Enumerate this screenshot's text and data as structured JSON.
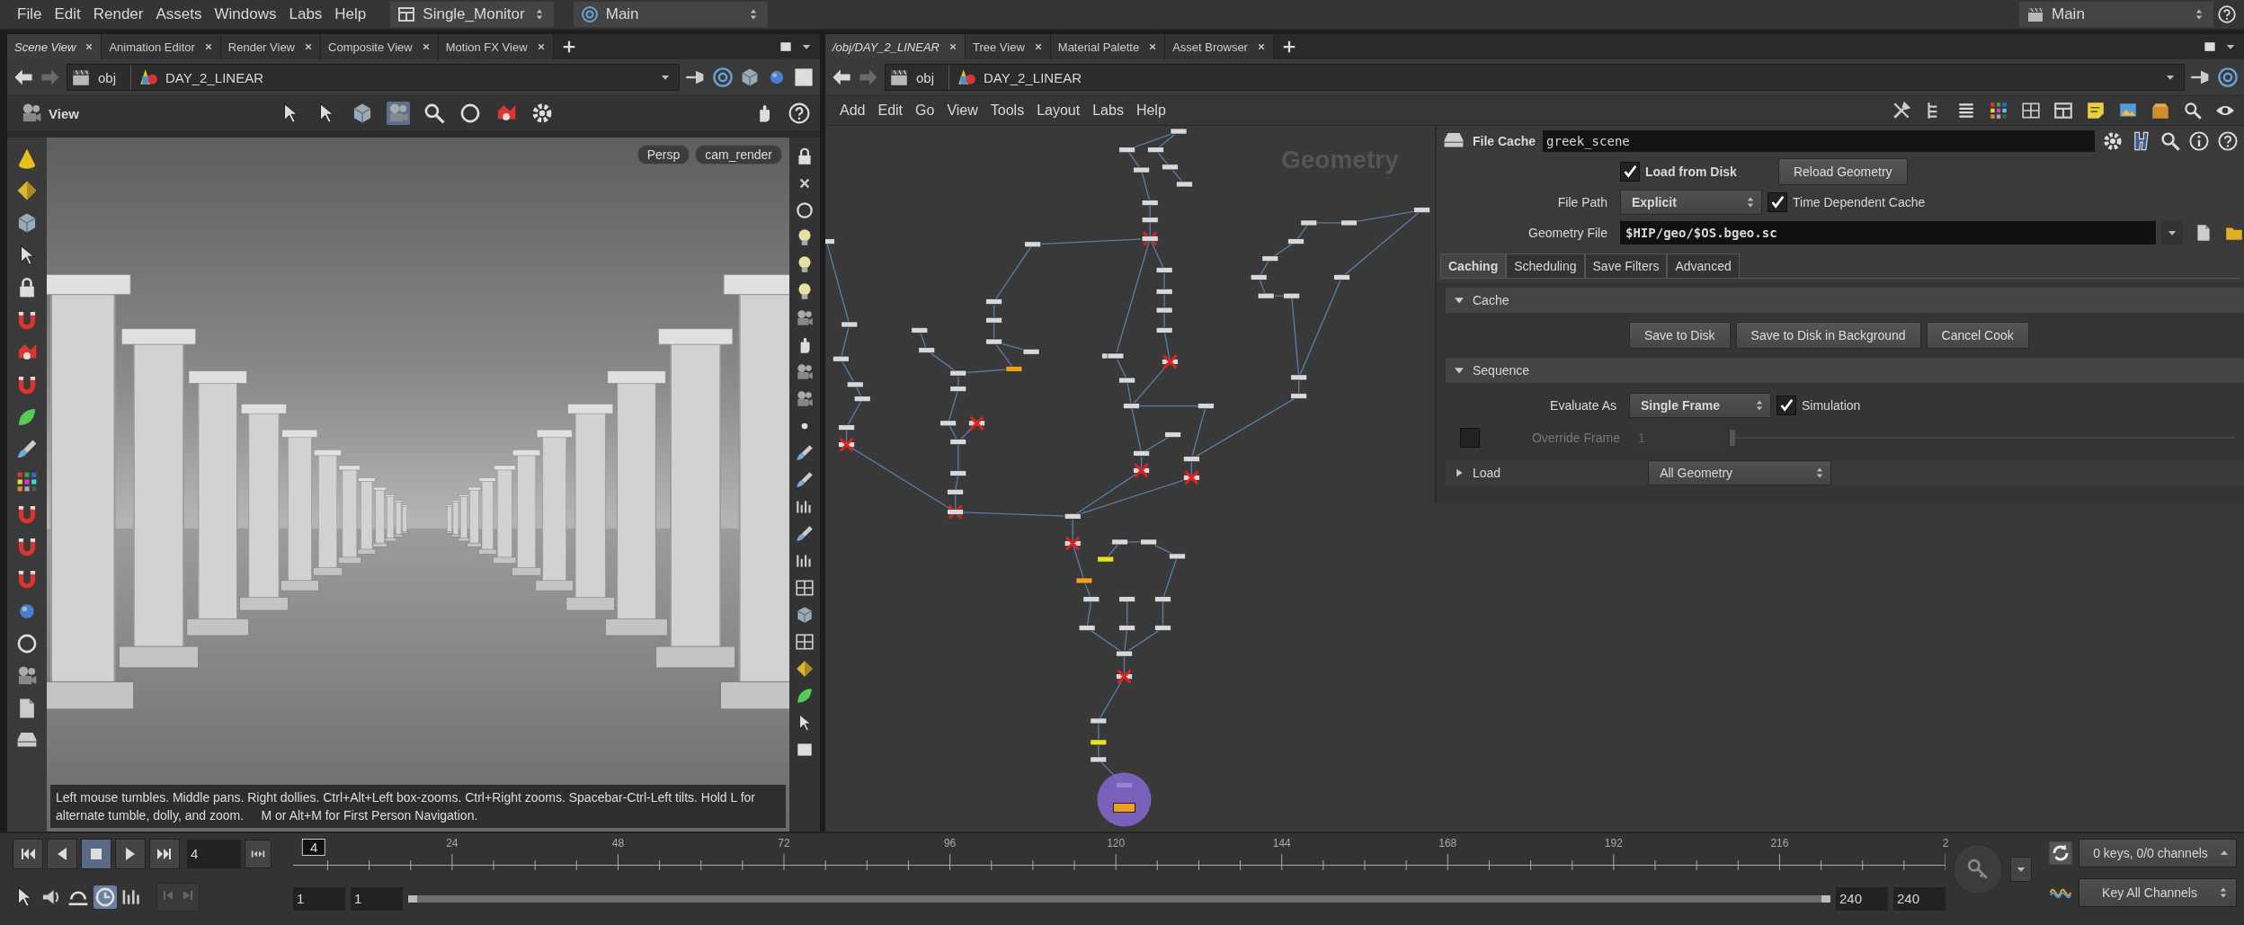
{
  "menu_bar": {
    "items": [
      "File",
      "Edit",
      "Render",
      "Assets",
      "Windows",
      "Labs",
      "Help"
    ],
    "desktop": "Single_Monitor",
    "context": "Main",
    "right_context": "Main"
  },
  "left_pane": {
    "tabs": [
      {
        "label": "Scene View",
        "selected": true
      },
      {
        "label": "Animation Editor",
        "selected": false
      },
      {
        "label": "Render View",
        "selected": false
      },
      {
        "label": "Composite View",
        "selected": false
      },
      {
        "label": "Motion FX View",
        "selected": false
      }
    ],
    "path": [
      "obj",
      "DAY_2_LINEAR"
    ],
    "toolbar_title": "View",
    "camera_menus": [
      "Persp",
      "cam_render"
    ],
    "hint": "Left mouse tumbles. Middle pans. Right dollies. Ctrl+Alt+Left box-zooms. Ctrl+Right zooms. Spacebar-Ctrl-Left tilts. Hold L for alternate tumble, dolly, and zoom.     M or Alt+M for First Person Navigation."
  },
  "right_pane": {
    "tabs": [
      {
        "label": "/obj/DAY_2_LINEAR",
        "selected": true
      },
      {
        "label": "Tree View",
        "selected": false
      },
      {
        "label": "Material Palette",
        "selected": false
      },
      {
        "label": "Asset Browser",
        "selected": false
      }
    ],
    "path": [
      "obj",
      "DAY_2_LINEAR"
    ],
    "network_menu": [
      "Add",
      "Edit",
      "Go",
      "View",
      "Tools",
      "Layout",
      "Labs",
      "Help"
    ],
    "network_label": "Geometry",
    "parameters": {
      "node_type": "File Cache",
      "node_name": "greek_scene",
      "load_from_disk": {
        "label": "Load from Disk",
        "checked": true
      },
      "reload_button": "Reload Geometry",
      "file_path": {
        "label": "File Path",
        "value": "Explicit"
      },
      "time_dependent": {
        "label": "Time Dependent Cache",
        "checked": true
      },
      "geometry_file": {
        "label": "Geometry File",
        "value": "$HIP/geo/$OS.bgeo.sc"
      },
      "tabs": [
        {
          "label": "Caching",
          "selected": true
        },
        {
          "label": "Scheduling",
          "selected": false
        },
        {
          "label": "Save Filters",
          "selected": false
        },
        {
          "label": "Advanced",
          "selected": false
        }
      ],
      "sections": [
        {
          "title": "Cache",
          "expanded": true,
          "kind": "buttons",
          "buttons": [
            "Save to Disk",
            "Save to Disk in Background",
            "Cancel Cook"
          ]
        },
        {
          "title": "Sequence",
          "expanded": true,
          "kind": "sequence",
          "evaluate": {
            "label": "Evaluate As",
            "value": "Single Frame"
          },
          "simulation": {
            "label": "Simulation",
            "checked": true
          },
          "override": {
            "label": "Override Frame",
            "checked": false,
            "disabled": true,
            "value": "1",
            "level": 0
          }
        },
        {
          "title": "Load",
          "expanded": false,
          "kind": "menu",
          "value": "All Geometry"
        }
      ]
    }
  },
  "timeline": {
    "frame": "4",
    "current_frame": "4",
    "ruler_labels": [
      "24",
      "48",
      "72",
      "96",
      "120",
      "144",
      "168",
      "192",
      "216",
      "2"
    ],
    "range_start": [
      "1",
      "1"
    ],
    "range_end": [
      "240",
      "240"
    ],
    "range_slider": {
      "level": 1
    },
    "keys_info": "0 keys, 0/0 channels",
    "key_mode": "Key All Channels"
  }
}
